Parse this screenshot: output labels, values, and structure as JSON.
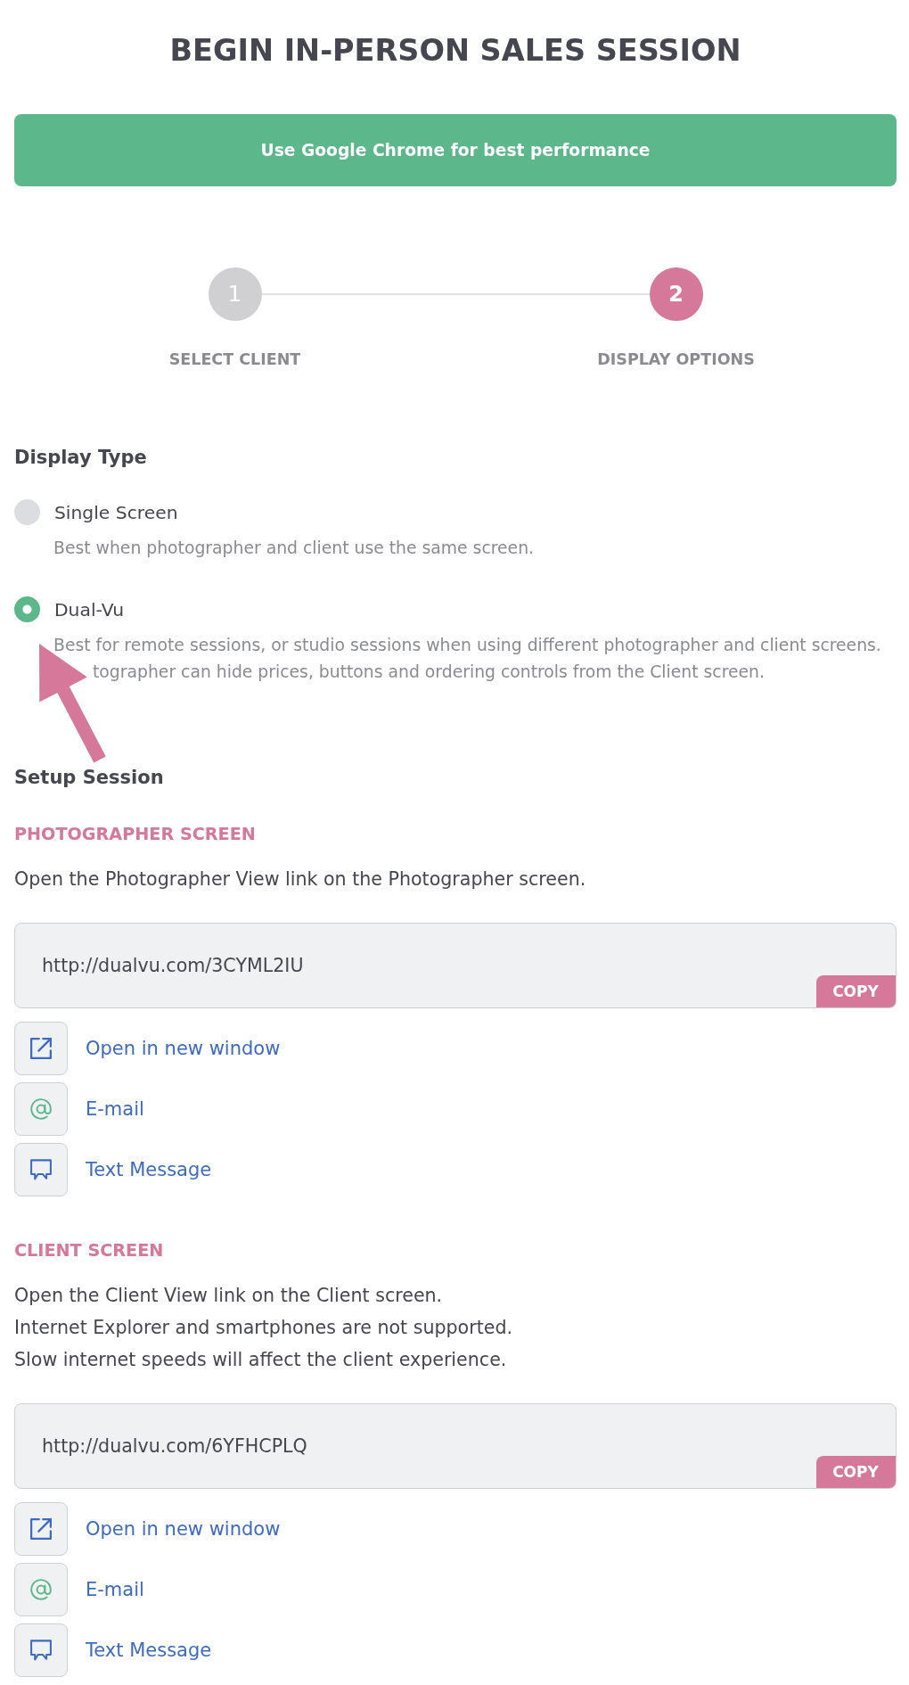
{
  "title": "BEGIN IN-PERSON SALES SESSION",
  "banner": {
    "text": "Use Google Chrome for best performance"
  },
  "steps": [
    {
      "number": "1",
      "label": "SELECT CLIENT",
      "selected": false
    },
    {
      "number": "2",
      "label": "DISPLAY OPTIONS",
      "selected": true
    }
  ],
  "display_type": {
    "heading": "Display Type",
    "options": [
      {
        "label": "Single Screen",
        "description": [
          "Best when photographer and client use the same screen."
        ],
        "selected": false,
        "arrow": false
      },
      {
        "label": "Dual-Vu",
        "description": [
          "Best for remote sessions, or studio sessions when using different photographer and client screens.",
          "tographer can hide prices, buttons and ordering controls from the Client screen."
        ],
        "selected": true,
        "arrow": true
      }
    ]
  },
  "setup": {
    "heading": "Setup Session",
    "screens": [
      {
        "heading": "PHOTOGRAPHER SCREEN",
        "notes": [
          "Open the Photographer View link on the Photographer screen."
        ],
        "url": "http://dualvu.com/3CYML2IU",
        "copy_button": "COPY",
        "actions": [
          {
            "kind": "open",
            "label": "Open in new window"
          },
          {
            "kind": "email",
            "label": "E-mail"
          },
          {
            "kind": "sms",
            "label": "Text Message"
          }
        ]
      },
      {
        "heading": "CLIENT SCREEN",
        "notes": [
          "Open the Client View link on the Client screen.",
          "Internet Explorer and smartphones are not supported.",
          "Slow internet speeds will affect the client experience."
        ],
        "url": "http://dualvu.com/6YFHCPLQ",
        "copy_button": "COPY",
        "actions": [
          {
            "kind": "open",
            "label": "Open in new window"
          },
          {
            "kind": "email",
            "label": "E-mail"
          },
          {
            "kind": "sms",
            "label": "Text Message"
          }
        ]
      }
    ]
  }
}
